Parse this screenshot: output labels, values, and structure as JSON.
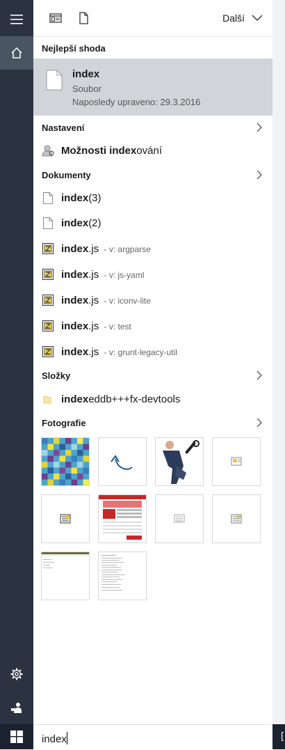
{
  "toolbar": {
    "more_label": "Další"
  },
  "best_match": {
    "header": "Nejlepší shoda",
    "title": "index",
    "type": "Soubor",
    "modified": "Naposledy upraveno: 29.3.2016"
  },
  "settings": {
    "header": "Nastavení",
    "items": [
      {
        "bold": "Možnosti index",
        "rest": "ování"
      }
    ]
  },
  "documents": {
    "header": "Dokumenty",
    "items": [
      {
        "bold": "index",
        "rest": "(3)",
        "meta": "",
        "icon": "document-icon"
      },
      {
        "bold": "index",
        "rest": "(2)",
        "meta": "",
        "icon": "document-icon"
      },
      {
        "bold": "index",
        "rest": ".js",
        "meta": " - v: argparse",
        "icon": "js-file-icon"
      },
      {
        "bold": "index",
        "rest": ".js",
        "meta": " - v: js-yaml",
        "icon": "js-file-icon"
      },
      {
        "bold": "index",
        "rest": ".js",
        "meta": " - v: iconv-lite",
        "icon": "js-file-icon"
      },
      {
        "bold": "index",
        "rest": ".js",
        "meta": " - v: test",
        "icon": "js-file-icon"
      },
      {
        "bold": "index",
        "rest": ".js",
        "meta": " - v: grunt-legacy-util",
        "icon": "js-file-icon"
      }
    ]
  },
  "folders": {
    "header": "Složky",
    "items": [
      {
        "bold": "index",
        "rest": "eddb+++fx-devtools"
      }
    ]
  },
  "photos": {
    "header": "Fotografie"
  },
  "search": {
    "query": "index"
  },
  "colors": {
    "rail": "#2b3340",
    "rail_active": "#4a5563",
    "selected": "#d1d4d9"
  }
}
